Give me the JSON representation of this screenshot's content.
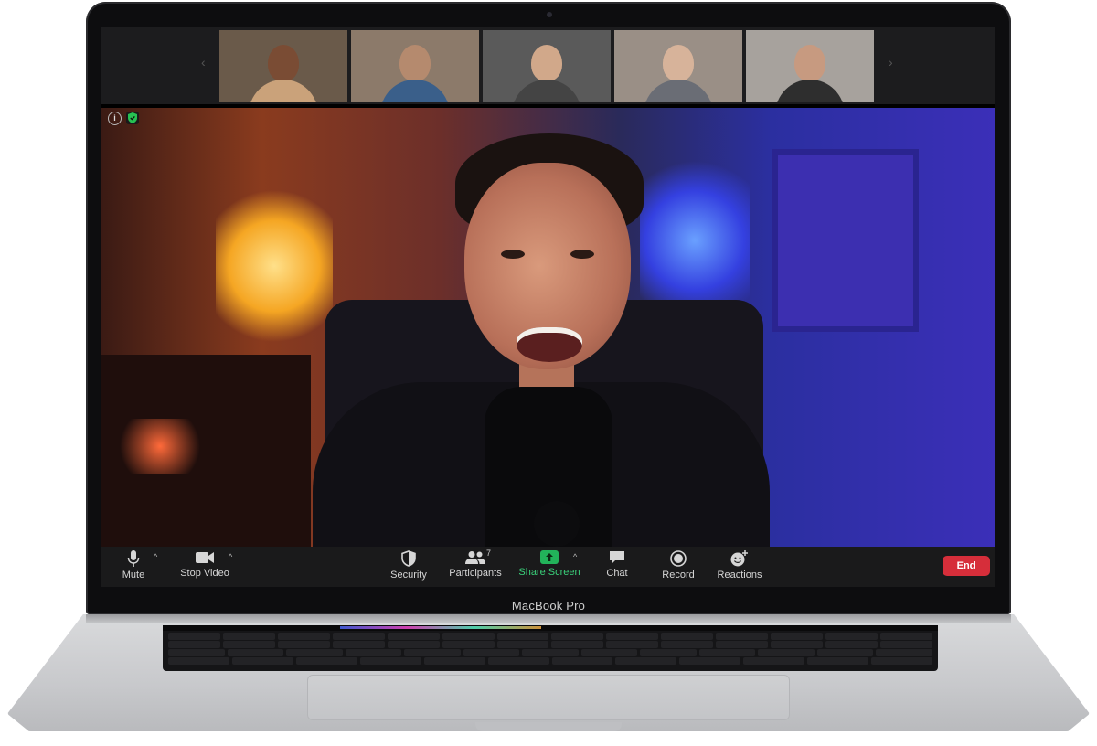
{
  "laptop": {
    "model_label": "MacBook Pro"
  },
  "call": {
    "participants_count": "7",
    "thumbnails": [
      {
        "bg": "#6a5a4a",
        "skin": "#7a4c34",
        "shirt": "#caa27a"
      },
      {
        "bg": "#8c7a6a",
        "skin": "#b58a6e",
        "shirt": "#3a5f8a"
      },
      {
        "bg": "#5a5a5a",
        "skin": "#d1a88a",
        "shirt": "#444"
      },
      {
        "bg": "#9a8f86",
        "skin": "#d7b39a",
        "shirt": "#6a6d75"
      },
      {
        "bg": "#a7a29d",
        "skin": "#c79a80",
        "shirt": "#2e2e2e"
      }
    ]
  },
  "toolbar": {
    "mute_label": "Mute",
    "stop_video_label": "Stop Video",
    "security_label": "Security",
    "participants_label": "Participants",
    "share_screen_label": "Share Screen",
    "chat_label": "Chat",
    "record_label": "Record",
    "reactions_label": "Reactions",
    "end_label": "End"
  },
  "colors": {
    "share_green": "#22b35a",
    "end_red": "#d62e3a",
    "toolbar_bg": "#1a1a1b"
  }
}
